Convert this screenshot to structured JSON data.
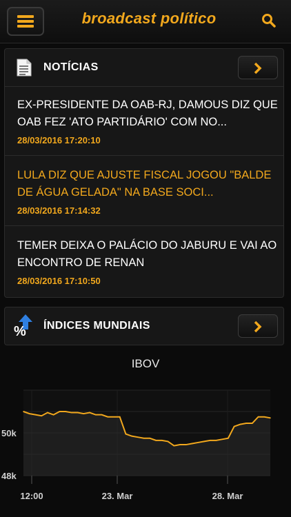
{
  "app": {
    "title": "broadcast político"
  },
  "noticias": {
    "title": "NOTÍCIAS",
    "items": [
      {
        "headline": "EX-PRESIDENTE DA OAB-RJ, DAMOUS DIZ QUE OAB FEZ 'ATO PARTIDÁRIO' COM NO...",
        "time": "28/03/2016 17:20:10",
        "highlighted": false
      },
      {
        "headline": "LULA DIZ QUE AJUSTE FISCAL JOGOU \"BALDE DE ÁGUA GELADA\" NA BASE SOCI...",
        "time": "28/03/2016 17:14:32",
        "highlighted": true
      },
      {
        "headline": "TEMER DEIXA O PALÁCIO DO JABURU E VAI AO ENCONTRO DE RENAN",
        "time": "28/03/2016 17:10:50",
        "highlighted": false
      }
    ]
  },
  "indices": {
    "title": "ÍNDICES MUNDIAIS"
  },
  "colors": {
    "accent": "#f2a81d",
    "background": "#0b0b0b",
    "panel": "#171717"
  },
  "chart_data": {
    "type": "line",
    "title": "IBOV",
    "xlabel": "",
    "ylabel": "",
    "x_ticks": [
      "12:00",
      "23. Mar",
      "28. Mar"
    ],
    "y_ticks": [
      "48k",
      "50k"
    ],
    "y_tick_values": [
      48000,
      50000
    ],
    "ylim": [
      48000,
      52000
    ],
    "grid": "horizontal",
    "series": [
      {
        "values": [
          51000,
          50900,
          50850,
          50800,
          50950,
          50850,
          51000,
          51000,
          50950,
          50950,
          50900,
          50950,
          50850,
          50850,
          50750,
          50750,
          50750,
          49950,
          49850,
          49800,
          49750,
          49750,
          49650,
          49650,
          49600,
          49400,
          49450,
          49450,
          49500,
          49550,
          49600,
          49650,
          49650,
          49700,
          49750,
          50300,
          50400,
          50450,
          50450,
          50750,
          50750,
          50700
        ]
      }
    ]
  }
}
